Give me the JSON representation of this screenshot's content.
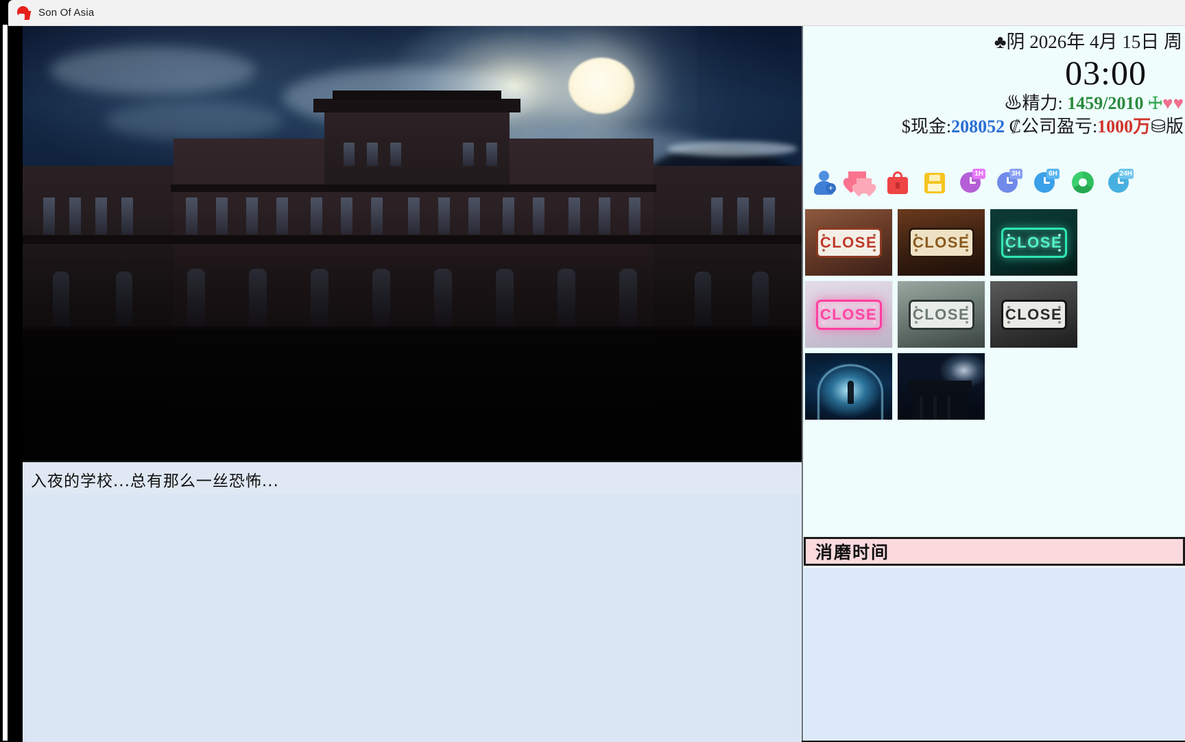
{
  "window": {
    "title": "Son Of Asia",
    "app_icon": "qt-logo-icon"
  },
  "stage": {
    "scene_alt": "night-school-building-with-full-moon"
  },
  "dialogue": {
    "text": "入夜的学校...总有那么一丝恐怖..."
  },
  "status": {
    "weather_icon": "♣",
    "weather_label": "阴",
    "date": "2026年 4月 15日 周",
    "date_full": "♣阴 2026年 4月 15日 周",
    "clock": "03:00",
    "energy_icon": "♨",
    "energy_label": "精力:",
    "energy_value": "1459/2010",
    "vine_icon": "🜊",
    "heart_icons": "♥♥",
    "cash_icon": "$",
    "cash_label": "现金:",
    "cash_value": "208052",
    "profit_icon": "₡",
    "profit_label": "公司盈亏:",
    "profit_value": "1000万",
    "extra_icon": "⛁",
    "extra_label": "版"
  },
  "toolbar": {
    "icons": [
      {
        "name": "add-person-icon",
        "label": "人物"
      },
      {
        "name": "hearts-icon",
        "label": "好感"
      },
      {
        "name": "briefcase-icon",
        "label": "工作"
      },
      {
        "name": "save-icon",
        "label": "存档"
      },
      {
        "name": "clock-1h-icon",
        "label": "1H",
        "badge": "1H"
      },
      {
        "name": "clock-3h-icon",
        "label": "3H",
        "badge": "3H"
      },
      {
        "name": "clock-6h-icon",
        "label": "6H",
        "badge": "6H"
      },
      {
        "name": "recycle-icon",
        "label": "刷新"
      },
      {
        "name": "clock-24h-icon",
        "label": "24H",
        "badge": "24H"
      }
    ]
  },
  "thumbnails": [
    {
      "name": "thumb-close-red",
      "sign_text": "CLOSE",
      "style": "t1"
    },
    {
      "name": "thumb-close-brown",
      "sign_text": "CLOSE",
      "style": "t2"
    },
    {
      "name": "thumb-close-green",
      "sign_text": "CLOSE",
      "style": "t3"
    },
    {
      "name": "thumb-close-pink",
      "sign_text": "CLOSE",
      "style": "t4"
    },
    {
      "name": "thumb-close-faded",
      "sign_text": "CLOSE",
      "style": "t5"
    },
    {
      "name": "thumb-close-dark",
      "sign_text": "CLOSE",
      "style": "t6"
    },
    {
      "name": "thumb-tunnel-blue",
      "sign_text": "",
      "style": "t7"
    },
    {
      "name": "thumb-night-building",
      "sign_text": "",
      "style": "t8"
    }
  ],
  "action_bar": {
    "label": "消磨时间"
  },
  "rail": {
    "chevron": "›"
  },
  "colors": {
    "panel_bg": "#f0fdfd",
    "dialogue_bg": "#dfe8f3",
    "action_bar_bg": "#fadadd",
    "cash_color": "#2a6fd4",
    "profit_color": "#d0342c",
    "energy_color": "#2a8a3e",
    "accent_red": "#e8201c"
  }
}
